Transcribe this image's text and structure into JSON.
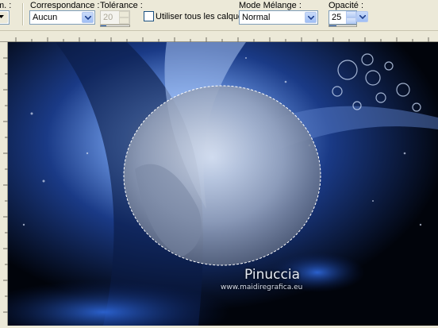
{
  "toolbar": {
    "cut_label": "m. :",
    "correspondance_label": "Correspondance :",
    "correspondance_value": "Aucun",
    "tolerance_label": "Tolérance :",
    "tolerance_value": "20",
    "tolerance_level": 0.2,
    "use_all_layers_label": "Utiliser tous les calques",
    "use_all_layers_checked": false,
    "blend_mode_label": "Mode Mélange :",
    "blend_mode_value": "Normal",
    "opacity_label": "Opacité :",
    "opacity_value": "25",
    "opacity_level": 0.25
  },
  "canvas": {
    "watermark_name": "Pinuccia",
    "watermark_url": "www.maidiregrafica.eu",
    "colors": {
      "background": "#02050c",
      "accent": "#2f6ae0",
      "selection": "#ffffff"
    }
  }
}
